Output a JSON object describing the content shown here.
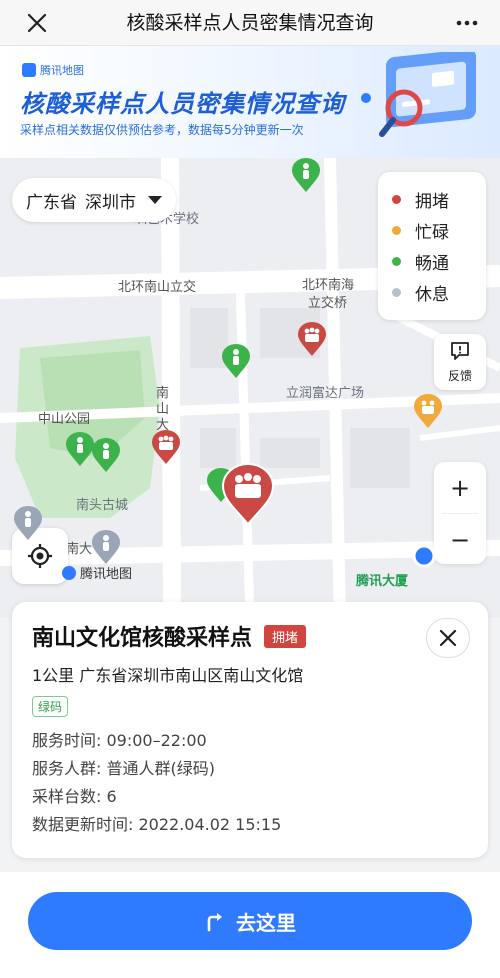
{
  "topbar": {
    "title": "核酸采样点人员密集情况查询"
  },
  "banner": {
    "brand": "腾讯地图",
    "headline": "核酸采样点人员密集情况查询",
    "subtitle": "采样点相关数据仅供预估参考，数据每5分钟更新一次"
  },
  "map": {
    "province": "广东省",
    "city": "深圳市",
    "labels": {
      "art_school": "圳艺术学校",
      "north_ring_1": "北环南山立交",
      "north_ring_2a": "北环南海",
      "north_ring_2b": "立交桥",
      "plaza": "立润富达广场",
      "park": "中山公园",
      "old_town": "南头古城",
      "road_v": "南山大",
      "road_s": "南大",
      "tencent": "腾讯大厦",
      "maplogo": "腾讯地图"
    },
    "legend": [
      {
        "label": "拥堵",
        "color": "#d0453e"
      },
      {
        "label": "忙碌",
        "color": "#f2a93b"
      },
      {
        "label": "畅通",
        "color": "#3bb34a"
      },
      {
        "label": "休息",
        "color": "#b8c0cc"
      }
    ],
    "feedback_label": "反馈",
    "zoom_in": "+",
    "zoom_out": "−"
  },
  "card": {
    "name": "南山文化馆核酸采样点",
    "status": "拥堵",
    "address": "1公里  广东省深圳市南山区南山文化馆",
    "tag": "绿码",
    "service_time": "服务时间: 09:00–22:00",
    "service_people": "服务人群: 普通人群(绿码)",
    "stations": "采样台数: 6",
    "updated": "数据更新时间: 2022.04.02 15:15"
  },
  "action": {
    "go_label": "去这里"
  },
  "colors": {
    "accent": "#2f7bff",
    "busy": "#d0453e",
    "green": "#3bb34a",
    "orange": "#f2a93b"
  }
}
